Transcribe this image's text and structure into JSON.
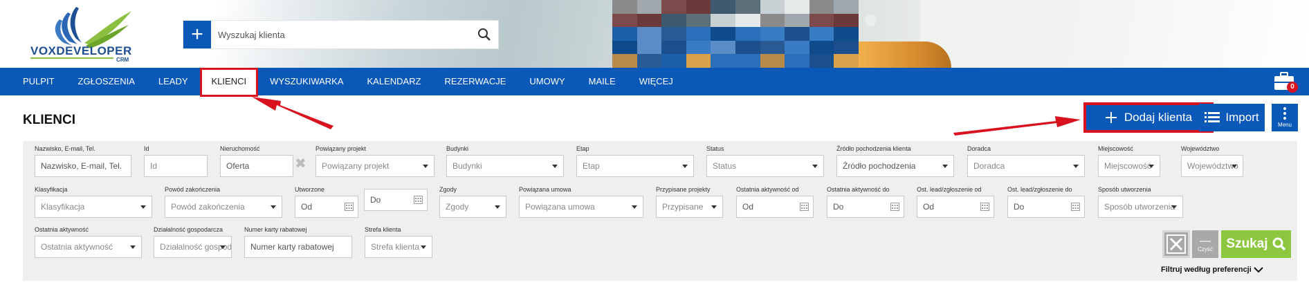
{
  "brand": {
    "logo_text": "VOXDEVELOPER",
    "logo_sub": "CRM",
    "primary": "#0a58b8",
    "accent_green": "#8dc63f",
    "highlight_red": "#d9121f"
  },
  "search": {
    "placeholder": "Wyszukaj klienta"
  },
  "nav": {
    "items": [
      "PULPIT",
      "ZGŁOSZENIA",
      "LEADY",
      "KLIENCI",
      "WYSZUKIWARKA",
      "KALENDARZ",
      "REZERWACJE",
      "UMOWY",
      "MAILE",
      "WIĘCEJ"
    ],
    "active": "KLIENCI",
    "cart_badge": "0"
  },
  "page": {
    "title": "KLIENCI",
    "add_label": "Dodaj klienta",
    "import_label": "Import",
    "menu_label": "Menu"
  },
  "filters": {
    "row1": [
      {
        "label": "Nazwisko, E-mail, Tel.",
        "value": "Nazwisko, E-mail, Tel."
      },
      {
        "label": "Id",
        "value": "Id"
      },
      {
        "label": "Nieruchomość",
        "value": "Oferta"
      },
      {
        "label": "Powiązany projekt",
        "value": "Powiązany projekt"
      },
      {
        "label": "Budynki",
        "value": "Budynki"
      },
      {
        "label": "Etap",
        "value": "Etap"
      },
      {
        "label": "Status",
        "value": "Status"
      },
      {
        "label": "Źródło pochodzenia klienta",
        "value": "Źródło pochodzenia"
      },
      {
        "label": "Doradca",
        "value": "Doradca"
      },
      {
        "label": "Miejscowość",
        "value": "Miejscowość"
      },
      {
        "label": "Województwo",
        "value": "Województwo"
      }
    ],
    "row2": [
      {
        "label": "Klasyfikacja",
        "value": "Klasyfikacja"
      },
      {
        "label": "Powód zakończenia",
        "value": "Powód zakończenia"
      },
      {
        "label": "Utworzone",
        "value": "Od"
      },
      {
        "label": "",
        "value": "Do"
      },
      {
        "label": "Zgody",
        "value": "Zgody"
      },
      {
        "label": "Powiązana umowa",
        "value": "Powiązana umowa"
      },
      {
        "label": "Przypisane projekty",
        "value": "Przypisane"
      },
      {
        "label": "Ostatnia aktywność od",
        "value": "Od"
      },
      {
        "label": "Ostatnia aktywność do",
        "value": "Do"
      },
      {
        "label": "Ost. lead/zgłoszenie od",
        "value": "Od"
      },
      {
        "label": "Ost. lead/zgłoszenie do",
        "value": "Do"
      },
      {
        "label": "Sposób utworzenia",
        "value": "Sposób utworzenia"
      }
    ],
    "row3": [
      {
        "label": "Ostatnia aktywność",
        "value": "Ostatnia aktywność"
      },
      {
        "label": "Działalność gospodarcza",
        "value": "Działalność gospodarcza"
      },
      {
        "label": "Numer karty rabatowej",
        "value": "Numer karty rabatowej"
      },
      {
        "label": "Strefa klienta",
        "value": "Strefa klienta"
      }
    ],
    "clear_label": "Czyść",
    "search_label": "Szukaj",
    "preferences_label": "Filtruj według preferencji"
  }
}
